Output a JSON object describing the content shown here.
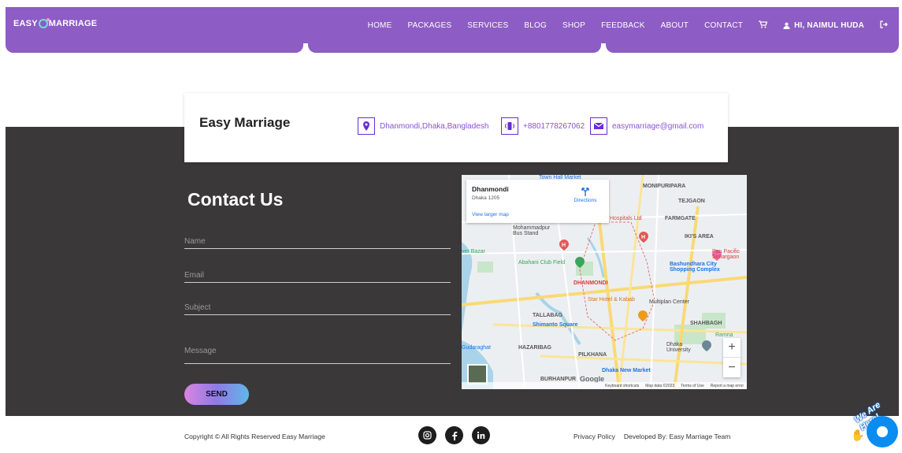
{
  "brand": {
    "left": "EASY",
    "right": "MARRIAGE"
  },
  "nav": {
    "items": [
      "HOME",
      "PACKAGES",
      "SERVICES",
      "BLOG",
      "SHOP",
      "FEEDBACK",
      "ABOUT",
      "CONTACT"
    ],
    "user_label": "HI, NAIMUL HUDA",
    "cart_icon": "cart-icon",
    "logout_icon": "logout-icon"
  },
  "info": {
    "title": "Easy Marriage",
    "address": "Dhanmondi,Dhaka,Bangladesh",
    "phone": "+8801778267062",
    "email": "easymarriage@gmail.com"
  },
  "contact": {
    "title": "Contact Us",
    "name_placeholder": "Name",
    "email_placeholder": "Email",
    "subject_placeholder": "Subject",
    "message_placeholder": "Message",
    "send_label": "SEND"
  },
  "map": {
    "place": "Dhanmondi",
    "address": "Dhaka 1205",
    "view_larger": "View larger map",
    "directions": "Directions",
    "labels": {
      "town_hall": "Town Hall Market",
      "monipuripara": "MONIPURIPARA",
      "tejgaon": "TEJGAON",
      "farmgate": "FARMGATE",
      "ikis_area": "IKI'S AREA",
      "mohammadpur": "Mohammadpur Bus Stand",
      "abahani": "Abahani Club Field",
      "bashundhara": "Bashundhara City Shopping Complex",
      "pan_pacific": "Pan Pacific Sonargaon",
      "dhanmondi": "DHANMONDI",
      "star_hotel": "Star Hotel & Kabab",
      "multiplan": "Multiplan Center",
      "tallabag": "TALLABAG",
      "shimanto": "Shimanto Square",
      "shahbagh": "SHAHBAGH",
      "ramna": "Ramna",
      "hazaribag": "HAZARIBAG",
      "pilkhana": "PILKHANA",
      "dhaka_univ": "Dhaka University",
      "dhaka_new_market": "Dhaka New Market",
      "burhanpur": "BURHANPUR",
      "gudaraghat": "Gudaraghat",
      "bazar": "ver Bazar",
      "hospitals": "Hospitals Ltd"
    },
    "footer": [
      "Keyboard shortcuts",
      "Map data ©2023",
      "Terms of Use",
      "Report a map error"
    ],
    "google": "Google",
    "zoom_in": "+",
    "zoom_out": "−"
  },
  "footer": {
    "copyright": "Copyright © All Rights Reserved Easy Marriage",
    "socials": [
      "instagram-icon",
      "facebook-icon",
      "linkedin-icon"
    ],
    "privacy": "Privacy Policy",
    "developed": "Developed By: Easy Marriage Team"
  },
  "chat": {
    "tag": "We Are Here!"
  },
  "colors": {
    "nav": "#8d5cc4",
    "dark": "#3a3838",
    "accent": "#6a2bd9"
  }
}
